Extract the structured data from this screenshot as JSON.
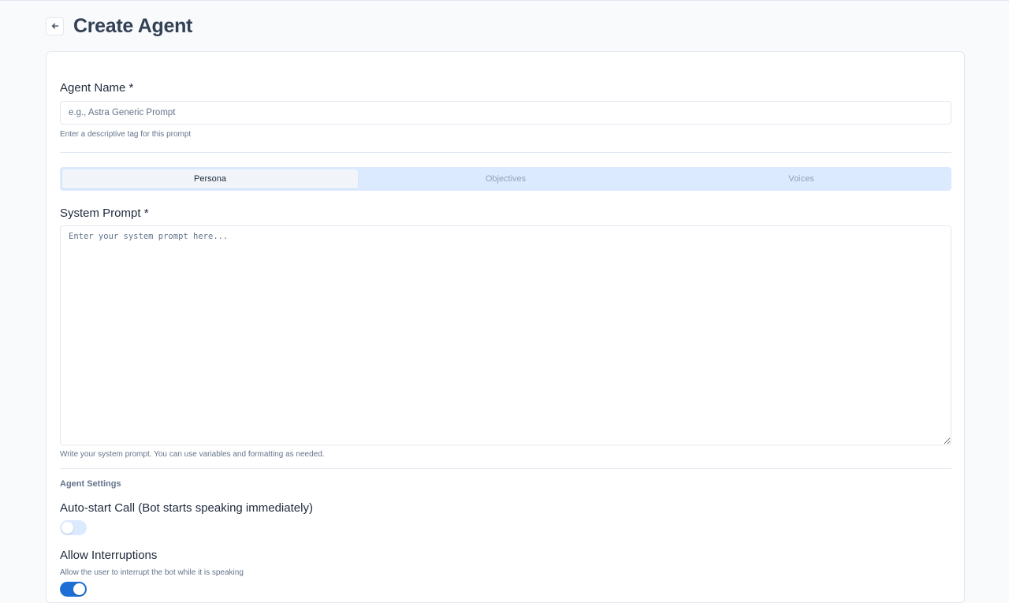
{
  "header": {
    "title": "Create Agent",
    "back_icon": "arrow-left-icon"
  },
  "form": {
    "agent_name": {
      "label": "Agent Name *",
      "placeholder": "e.g., Astra Generic Prompt",
      "value": "",
      "hint": "Enter a descriptive tag for this prompt"
    },
    "tabs": [
      {
        "label": "Persona",
        "active": true
      },
      {
        "label": "Objectives",
        "active": false
      },
      {
        "label": "Voices",
        "active": false
      }
    ],
    "system_prompt": {
      "label": "System Prompt *",
      "placeholder": "Enter your system prompt here...",
      "value": "",
      "hint": "Write your system prompt. You can use variables and formatting as needed."
    },
    "settings": {
      "title": "Agent Settings",
      "auto_start": {
        "label": "Auto-start Call (Bot starts speaking immediately)",
        "enabled": false
      },
      "interruptions": {
        "label": "Allow Interruptions",
        "hint": "Allow the user to interrupt the bot while it is speaking",
        "enabled": true
      }
    }
  },
  "colors": {
    "accent": "#1d6fd6",
    "tab_bg": "#dbeafe",
    "border": "#e2e8f0",
    "page_bg": "#f8fafc"
  }
}
